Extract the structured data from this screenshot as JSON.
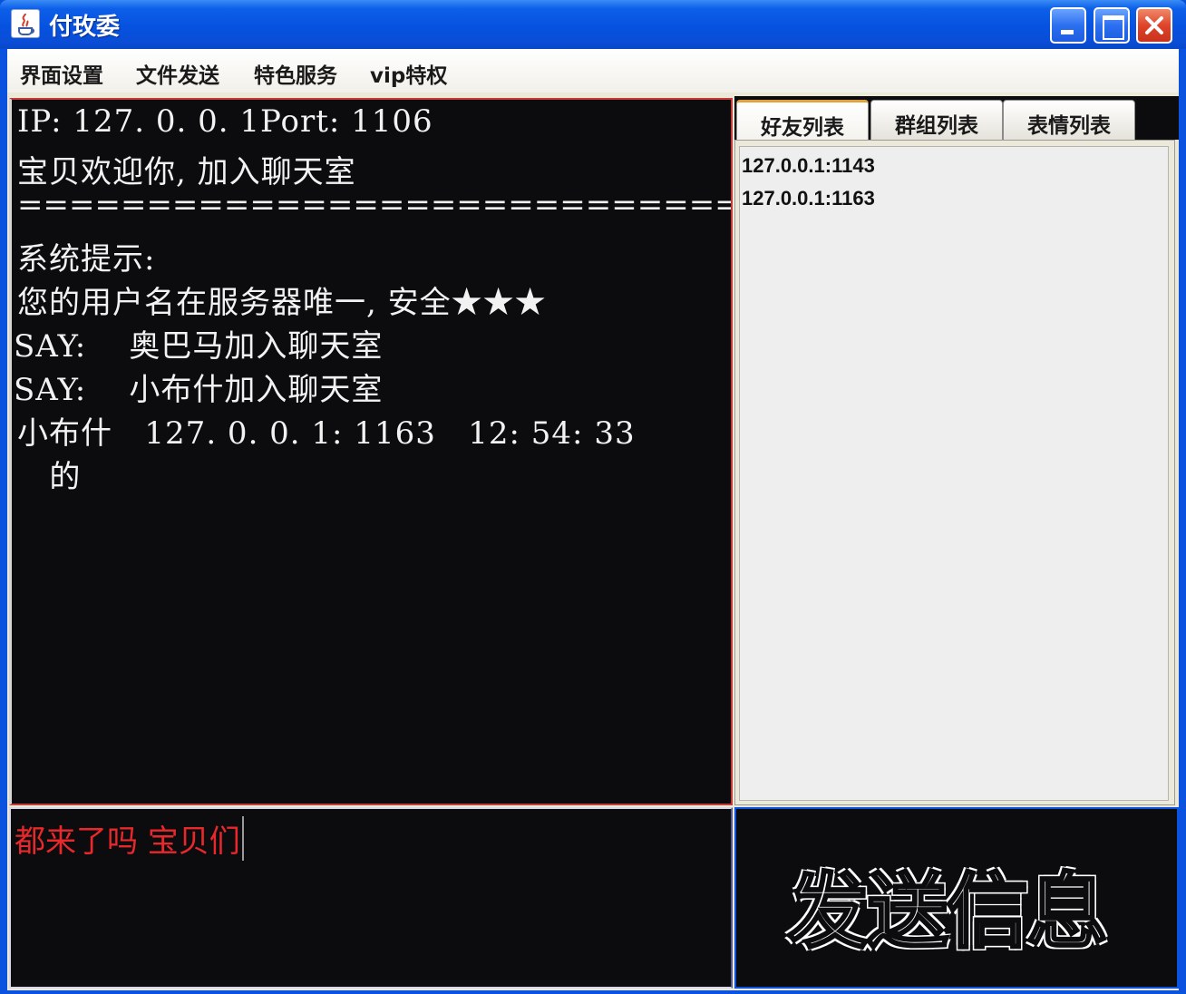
{
  "window": {
    "title": "付玫委",
    "controls": {
      "minimize": "minimize",
      "maximize": "maximize",
      "close": "close"
    }
  },
  "menu": {
    "items": [
      "界面设置",
      "文件发送",
      "特色服务",
      "vip特权"
    ]
  },
  "chat": {
    "lines": [
      "IP: 127. 0. 0. 1Port: 1106",
      "宝贝欢迎你, 加入聊天室",
      "=====================================",
      "系统提示:",
      "您的用户名在服务器唯一, 安全★★★",
      "SAY:    奥巴马加入聊天室",
      "SAY:    小布什加入聊天室",
      "小布什   127. 0. 0. 1: 1163   12: 54: 33",
      "   的"
    ]
  },
  "input": {
    "value": "都来了吗 宝贝们",
    "text_color": "#e8282a"
  },
  "tabs": [
    {
      "label": "好友列表",
      "active": true
    },
    {
      "label": "群组列表",
      "active": false
    },
    {
      "label": "表情列表",
      "active": false
    }
  ],
  "friends": [
    "127.0.0.1:1143",
    "127.0.0.1:1163"
  ],
  "send": {
    "label": "发送信息"
  },
  "colors": {
    "titlebar": "#0652e0",
    "chat_background": "#0c0c0f",
    "chat_text": "#f2f2f2",
    "chat_border": "#c23a3a"
  }
}
